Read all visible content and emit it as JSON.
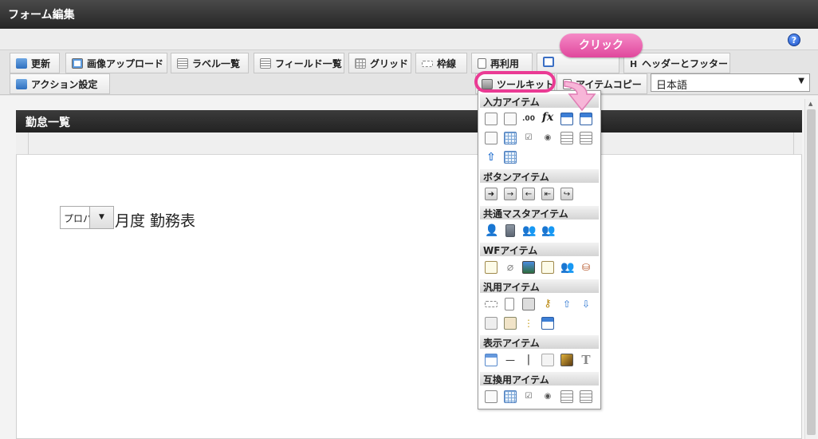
{
  "window": {
    "title": "フォーム編集"
  },
  "help": {
    "icon": "help-icon",
    "glyph": "?"
  },
  "toolbar": {
    "buttons": [
      {
        "label": "更新",
        "icon": "refresh-icon"
      },
      {
        "label": "画像アップロード",
        "icon": "image-upload-icon"
      },
      {
        "label": "ラベル一覧",
        "icon": "label-list-icon"
      },
      {
        "label": "フィールド一覧",
        "icon": "field-list-icon"
      },
      {
        "label": "グリッド",
        "icon": "grid-icon"
      },
      {
        "label": "枠線",
        "icon": "border-icon"
      },
      {
        "label": "再利用",
        "icon": "reuse-icon"
      },
      {
        "label": "ヘッダーとフッター",
        "icon": "header-footer-icon"
      },
      {
        "label": "アクション設定",
        "icon": "action-settings-icon"
      },
      {
        "label": "ツールキット",
        "icon": "toolkit-icon"
      },
      {
        "label": "アイテムコピー",
        "icon": "item-copy-icon"
      }
    ],
    "language": {
      "value": "日本語"
    }
  },
  "annotation": {
    "callout": "クリック",
    "color": "#e0479c"
  },
  "panel": {
    "title": "勤怠一覧"
  },
  "form": {
    "select_value": "プロパ",
    "title": "月度 勤務表"
  },
  "toolkit": {
    "sections": [
      {
        "title": "入力アイテム"
      },
      {
        "title": "ボタンアイテム"
      },
      {
        "title": "共通マスタアイテム"
      },
      {
        "title": "WFアイテム"
      },
      {
        "title": "汎用アイテム"
      },
      {
        "title": "表示アイテム"
      },
      {
        "title": "互換用アイテム"
      }
    ],
    "glyphs": {
      "decimal": "*.0\n.00",
      "fx": "fx"
    }
  },
  "colors": {
    "titlebar": "#262626",
    "accent": "#ea3b94",
    "panel_header": "#222222"
  }
}
